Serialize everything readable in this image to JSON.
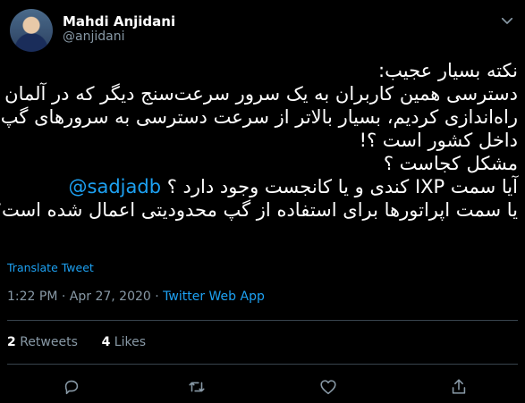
{
  "author": {
    "name": "Mahdi Anjidani",
    "handle": "@anjidani"
  },
  "tweet": {
    "lines": [
      "نکته بسیار عجیب:",
      "دسترسی همین کاربران به یک سرور سرعت‌سنج دیگر که در آلمان",
      "راه‌اندازی کردیم، بسیار بالاتر از سرعت دسترسی به سرورهای گپ در",
      "داخل کشور است ؟!",
      "مشکل کجاست ؟",
      "آیا سمت IXP کندی و یا کانجست وجود دارد ؟",
      "یا سمت اپراتورها برای استفاده از گپ محدودیتی اعمال شده است؟"
    ],
    "mention": "@sadjadb"
  },
  "translate_label": "Translate Tweet",
  "meta": {
    "time": "1:22 PM",
    "separator": " · ",
    "date": "Apr 27, 2020",
    "app": "Twitter Web App"
  },
  "stats": {
    "retweets_count": "2",
    "retweets_label": "Retweets",
    "likes_count": "4",
    "likes_label": "Likes"
  },
  "icons": {
    "more": "chevron-down-icon",
    "reply": "reply-icon",
    "retweet": "retweet-icon",
    "like": "heart-icon",
    "share": "share-icon"
  },
  "colors": {
    "background": "#000000",
    "accent": "#1da1f2",
    "muted": "#8899a6",
    "text": "#ffffff",
    "divider": "#38444d"
  }
}
